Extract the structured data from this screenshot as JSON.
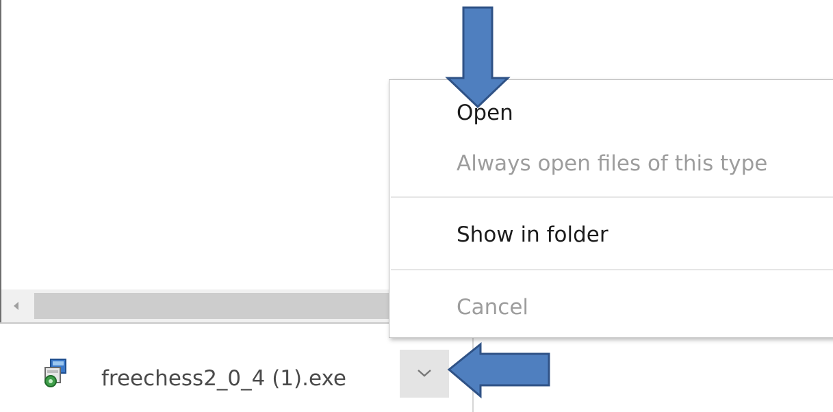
{
  "download_shelf": {
    "file_name": "freechess2_0_4 (1).exe",
    "file_icon": "installer-file-icon",
    "chevron_icon": "chevron-down-icon"
  },
  "context_menu": {
    "items": [
      {
        "label": "Open",
        "enabled": true
      },
      {
        "label": "Always open files of this type",
        "enabled": false
      },
      {
        "label": "Show in folder",
        "enabled": true
      },
      {
        "label": "Cancel",
        "enabled": false
      }
    ]
  },
  "annotations": {
    "arrow_color": "#4f7fbf",
    "arrow_outline": "#2f5286",
    "arrows": [
      "arrow-down-to-open",
      "arrow-left-to-chevron"
    ]
  },
  "colors": {
    "menu_text": "#1c1c1c",
    "menu_text_disabled": "#9d9d9d",
    "file_name_text": "#4a4a4a"
  }
}
